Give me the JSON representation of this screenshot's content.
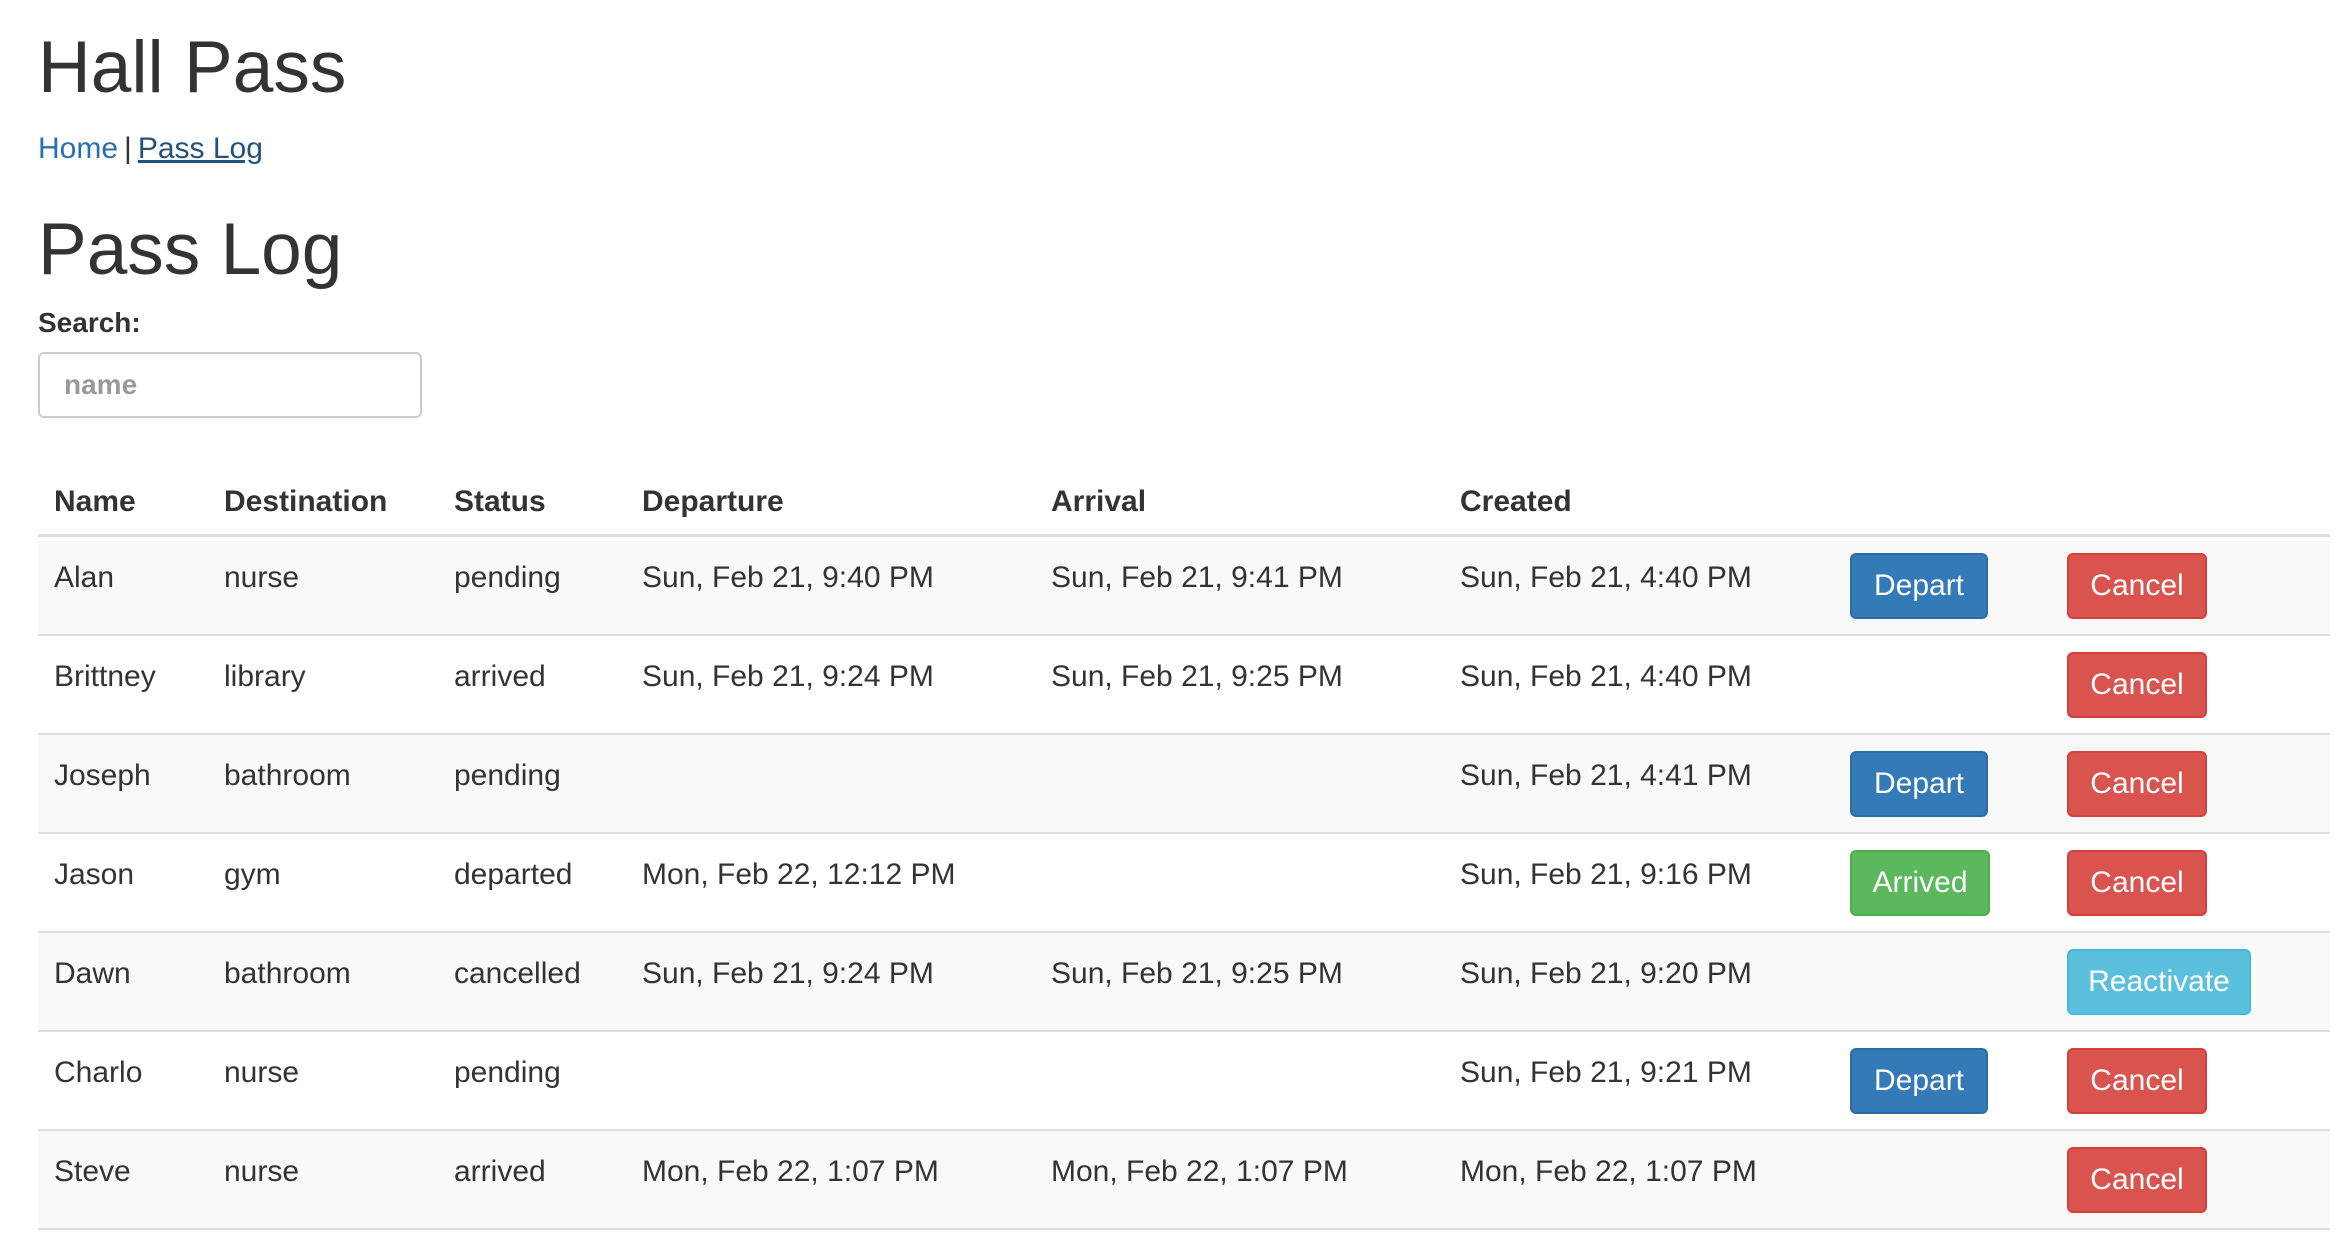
{
  "app": {
    "title": "Hall Pass"
  },
  "nav": {
    "home_label": "Home",
    "separator": "|",
    "pass_log_label": "Pass Log"
  },
  "page": {
    "title": "Pass Log"
  },
  "search": {
    "label": "Search:",
    "placeholder": "name",
    "value": ""
  },
  "table": {
    "columns": [
      "Name",
      "Destination",
      "Status",
      "Departure",
      "Arrival",
      "Created"
    ],
    "rows": [
      {
        "name": "Alan",
        "destination": "nurse",
        "status": "pending",
        "departure": "Sun, Feb 21, 9:40 PM",
        "arrival": "Sun, Feb 21, 9:41 PM",
        "created": "Sun, Feb 21, 4:40 PM",
        "action1": "Depart",
        "action2": "Cancel"
      },
      {
        "name": "Brittney",
        "destination": "library",
        "status": "arrived",
        "departure": "Sun, Feb 21, 9:24 PM",
        "arrival": "Sun, Feb 21, 9:25 PM",
        "created": "Sun, Feb 21, 4:40 PM",
        "action1": "",
        "action2": "Cancel"
      },
      {
        "name": "Joseph",
        "destination": "bathroom",
        "status": "pending",
        "departure": "",
        "arrival": "",
        "created": "Sun, Feb 21, 4:41 PM",
        "action1": "Depart",
        "action2": "Cancel"
      },
      {
        "name": "Jason",
        "destination": "gym",
        "status": "departed",
        "departure": "Mon, Feb 22, 12:12 PM",
        "arrival": "",
        "created": "Sun, Feb 21, 9:16 PM",
        "action1": "Arrived",
        "action2": "Cancel"
      },
      {
        "name": "Dawn",
        "destination": "bathroom",
        "status": "cancelled",
        "departure": "Sun, Feb 21, 9:24 PM",
        "arrival": "Sun, Feb 21, 9:25 PM",
        "created": "Sun, Feb 21, 9:20 PM",
        "action1": "",
        "action2": "Reactivate"
      },
      {
        "name": "Charlo",
        "destination": "nurse",
        "status": "pending",
        "departure": "",
        "arrival": "",
        "created": "Sun, Feb 21, 9:21 PM",
        "action1": "Depart",
        "action2": "Cancel"
      },
      {
        "name": "Steve",
        "destination": "nurse",
        "status": "arrived",
        "departure": "Mon, Feb 22, 1:07 PM",
        "arrival": "Mon, Feb 22, 1:07 PM",
        "created": "Mon, Feb 22, 1:07 PM",
        "action1": "",
        "action2": "Cancel"
      }
    ]
  },
  "colors": {
    "depart": "#337ab7",
    "arrived": "#5cb85c",
    "cancel": "#d9534f",
    "reactivate": "#5bc0de",
    "link": "#2a6fb0"
  }
}
